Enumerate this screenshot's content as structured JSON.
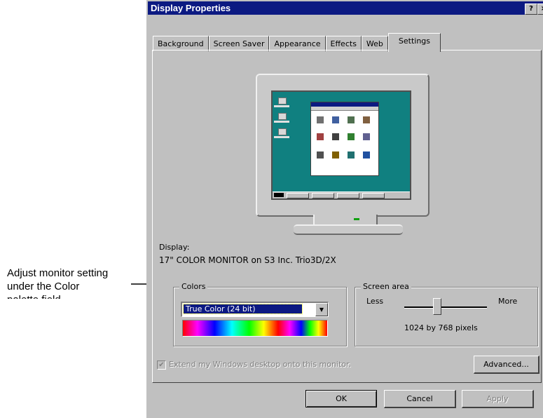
{
  "annotation": {
    "lines": [
      "Adjust monitor setting",
      "under the Color"
    ],
    "cut_line": "palette field"
  },
  "window": {
    "title": "Display Properties",
    "help_button": "?",
    "close_button": "×"
  },
  "tabs": [
    {
      "label": "Background"
    },
    {
      "label": "Screen Saver"
    },
    {
      "label": "Appearance"
    },
    {
      "label": "Effects"
    },
    {
      "label": "Web"
    },
    {
      "label": "Settings",
      "active": true
    }
  ],
  "display": {
    "label": "Display:",
    "value": "17\" COLOR MONITOR  on S3 Inc. Trio3D/2X"
  },
  "colors": {
    "group_title": "Colors",
    "selected": "True Color (24 bit)"
  },
  "screen_area": {
    "group_title": "Screen area",
    "less_label": "Less",
    "more_label": "More",
    "value_text": "1024 by 768 pixels",
    "slider_level": 0.4
  },
  "extend_checkbox": {
    "label": "Extend my Windows desktop onto this monitor.",
    "checked": true,
    "disabled": true
  },
  "buttons": {
    "advanced": "Advanced...",
    "ok": "OK",
    "cancel": "Cancel",
    "apply": "Apply"
  },
  "colors_theme": {
    "titlebar": "#0c1a82",
    "dialog_bg": "#c0c0c0",
    "desktop": "#108080"
  }
}
